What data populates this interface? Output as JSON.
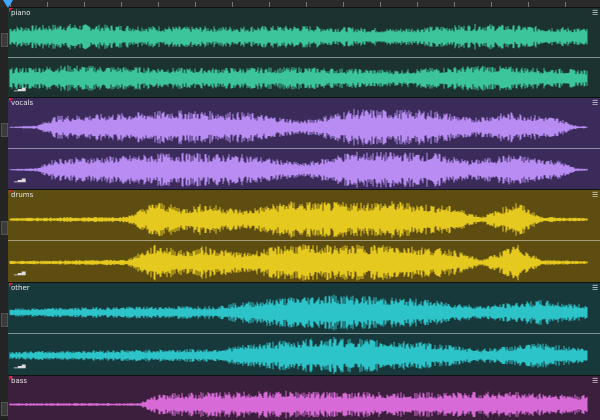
{
  "tracks": [
    {
      "name": "piano",
      "bg": "#1b3230",
      "wave": "#3cc49a"
    },
    {
      "name": "vocals",
      "bg": "#3a2b5a",
      "wave": "#b88cf2"
    },
    {
      "name": "drums",
      "bg": "#5e4d10",
      "wave": "#e6c91e"
    },
    {
      "name": "other",
      "bg": "#17393b",
      "wave": "#2cc4c8"
    },
    {
      "name": "bass",
      "bg": "#3b1f3d",
      "wave": "#d86ad8"
    }
  ],
  "icons": {
    "track_menu": "menu-icon",
    "level_meter": "level-meter-icon",
    "playhead": "playhead-icon"
  }
}
